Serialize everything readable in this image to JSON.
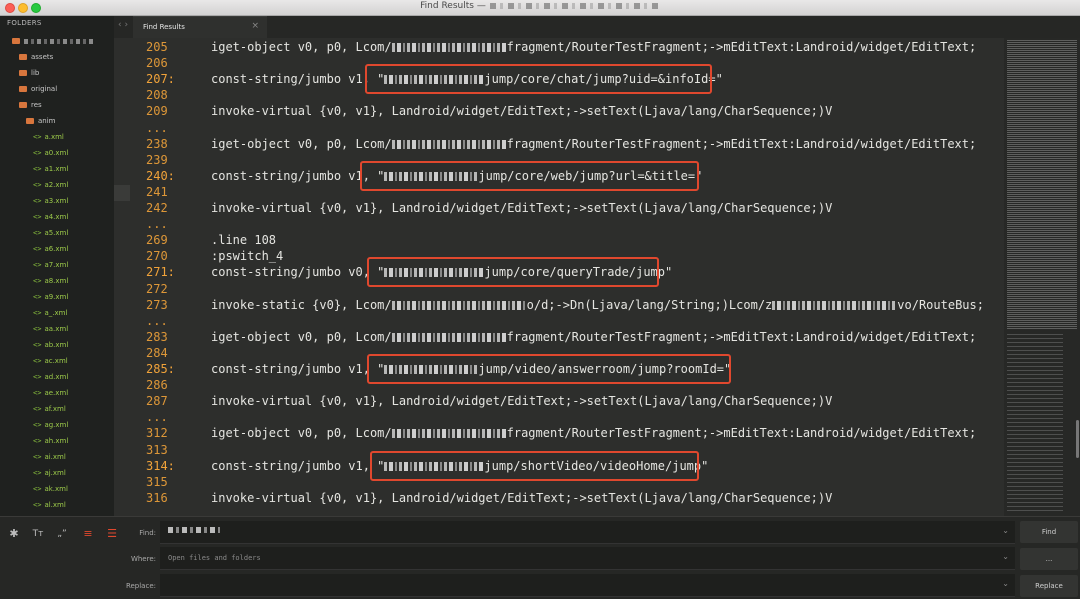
{
  "window": {
    "title": "Find Results —"
  },
  "sidebar": {
    "header": "FOLDERS",
    "items": [
      {
        "label": "",
        "type": "root"
      },
      {
        "label": "assets",
        "type": "folder"
      },
      {
        "label": "lib",
        "type": "folder"
      },
      {
        "label": "original",
        "type": "folder"
      },
      {
        "label": "res",
        "type": "folder"
      },
      {
        "label": "anim",
        "type": "folder"
      },
      {
        "label": "a.xml",
        "type": "file"
      },
      {
        "label": "a0.xml",
        "type": "file"
      },
      {
        "label": "a1.xml",
        "type": "file"
      },
      {
        "label": "a2.xml",
        "type": "file"
      },
      {
        "label": "a3.xml",
        "type": "file"
      },
      {
        "label": "a4.xml",
        "type": "file"
      },
      {
        "label": "a5.xml",
        "type": "file"
      },
      {
        "label": "a6.xml",
        "type": "file"
      },
      {
        "label": "a7.xml",
        "type": "file"
      },
      {
        "label": "a8.xml",
        "type": "file"
      },
      {
        "label": "a9.xml",
        "type": "file"
      },
      {
        "label": "a_.xml",
        "type": "file"
      },
      {
        "label": "aa.xml",
        "type": "file"
      },
      {
        "label": "ab.xml",
        "type": "file"
      },
      {
        "label": "ac.xml",
        "type": "file"
      },
      {
        "label": "ad.xml",
        "type": "file"
      },
      {
        "label": "ae.xml",
        "type": "file"
      },
      {
        "label": "af.xml",
        "type": "file"
      },
      {
        "label": "ag.xml",
        "type": "file"
      },
      {
        "label": "ah.xml",
        "type": "file"
      },
      {
        "label": "ai.xml",
        "type": "file"
      },
      {
        "label": "aj.xml",
        "type": "file"
      },
      {
        "label": "ak.xml",
        "type": "file"
      },
      {
        "label": "al.xml",
        "type": "file"
      }
    ]
  },
  "tab": {
    "label": "Find Results",
    "close": "×",
    "nav": "‹ ›"
  },
  "lines": [
    {
      "num": "205",
      "code_pre": "iget-object v0, p0, Lcom/",
      "code_post": "fragment/RouterTestFragment;->mEditText:Landroid/widget/EditText;",
      "blur": 115
    },
    {
      "num": "206",
      "code_pre": "",
      "code_post": ""
    },
    {
      "num": "207:",
      "match": true,
      "code_pre": "const-string/jumbo v1, \"",
      "code_post": "jump/core/chat/jump?uid=&infoId=\"",
      "blur": 100
    },
    {
      "num": "208",
      "code_pre": "",
      "code_post": ""
    },
    {
      "num": "209",
      "code_pre": "invoke-virtual {v0, v1}, Landroid/widget/EditText;->setText(Ljava/lang/CharSequence;)V",
      "code_post": ""
    },
    {
      "num": "...",
      "code_pre": "",
      "code_post": ""
    },
    {
      "num": "238",
      "code_pre": "iget-object v0, p0, Lcom/",
      "code_post": "fragment/RouterTestFragment;->mEditText:Landroid/widget/EditText;",
      "blur": 115
    },
    {
      "num": "239",
      "code_pre": "",
      "code_post": ""
    },
    {
      "num": "240:",
      "match": true,
      "code_pre": "const-string/jumbo v1, \"",
      "code_post": "jump/core/web/jump?url=&title=\"",
      "blur": 94
    },
    {
      "num": "241",
      "code_pre": "",
      "code_post": ""
    },
    {
      "num": "242",
      "code_pre": "invoke-virtual {v0, v1}, Landroid/widget/EditText;->setText(Ljava/lang/CharSequence;)V",
      "code_post": ""
    },
    {
      "num": "...",
      "code_pre": "",
      "code_post": ""
    },
    {
      "num": "269",
      "code_pre": ".line 108",
      "code_post": ""
    },
    {
      "num": "270",
      "code_pre": ":pswitch_4",
      "code_post": ""
    },
    {
      "num": "271:",
      "match": true,
      "code_pre": "const-string/jumbo v0, \"",
      "code_post": "jump/core/queryTrade/jump\"",
      "blur": 100
    },
    {
      "num": "272",
      "code_pre": "",
      "code_post": ""
    },
    {
      "num": "273",
      "code_pre": "invoke-static {v0}, Lcom/",
      "code_post": "o/d;->Dn(Ljava/lang/String;)Lcom/z",
      "code_tail": "vo/RouteBus;",
      "blur": 135,
      "blur2": 125
    },
    {
      "num": "...",
      "code_pre": "",
      "code_post": ""
    },
    {
      "num": "283",
      "code_pre": "iget-object v0, p0, Lcom/",
      "code_post": "fragment/RouterTestFragment;->mEditText:Landroid/widget/EditText;",
      "blur": 115
    },
    {
      "num": "284",
      "code_pre": "",
      "code_post": ""
    },
    {
      "num": "285:",
      "match": true,
      "code_pre": "const-string/jumbo v1, \"",
      "code_post": "jump/video/answerroom/jump?roomId=\"",
      "blur": 94
    },
    {
      "num": "286",
      "code_pre": "",
      "code_post": ""
    },
    {
      "num": "287",
      "code_pre": "invoke-virtual {v0, v1}, Landroid/widget/EditText;->setText(Ljava/lang/CharSequence;)V",
      "code_post": ""
    },
    {
      "num": "...",
      "code_pre": "",
      "code_post": ""
    },
    {
      "num": "312",
      "code_pre": "iget-object v0, p0, Lcom/",
      "code_post": "fragment/RouterTestFragment;->mEditText:Landroid/widget/EditText;",
      "blur": 115
    },
    {
      "num": "313",
      "code_pre": "",
      "code_post": ""
    },
    {
      "num": "314:",
      "match": true,
      "code_pre": "const-string/jumbo v1, \"",
      "code_post": "jump/shortVideo/videoHome/jump\"",
      "blur": 100
    },
    {
      "num": "315",
      "code_pre": "",
      "code_post": ""
    },
    {
      "num": "316",
      "code_pre": "invoke-virtual {v0, v1}, Landroid/widget/EditText;->setText(Ljava/lang/CharSequence;)V",
      "code_post": ""
    }
  ],
  "find_panel": {
    "find_label": "Find:",
    "where_label": "Where:",
    "where_placeholder": "Open files and folders",
    "replace_label": "Replace:",
    "find_button": "Find",
    "more_button": "...",
    "replace_button": "Replace",
    "options": [
      "✱",
      "Tт",
      "„”",
      "≡",
      "☰"
    ]
  },
  "colors": {
    "accent": "#e0482e",
    "line_number": "#f1a33a",
    "folder": "#d8763d",
    "file": "#8cc43e"
  }
}
